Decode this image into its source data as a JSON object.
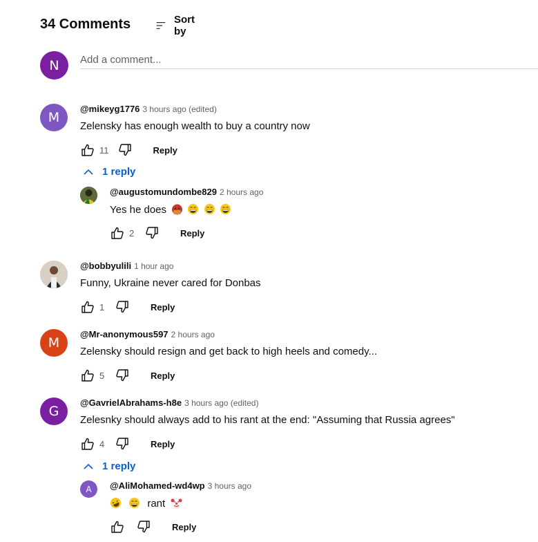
{
  "header": {
    "count_label": "34 Comments",
    "sort_label": "Sort by"
  },
  "add_comment": {
    "avatar_letter": "N",
    "avatar_color": "#7b1fa2",
    "placeholder": "Add a comment..."
  },
  "comments": [
    {
      "author": "@mikeyg1776",
      "time": "3 hours ago (edited)",
      "text": "Zelensky has enough wealth to buy a country now",
      "likes": "11",
      "reply_label": "Reply",
      "avatar_letter": "M",
      "avatar_color": "#7e57c2",
      "replies_toggle": "1 reply",
      "reply": {
        "author": "@augustomundombe829",
        "time": "2 hours ago",
        "text": "Yes he does",
        "emojis": [
          "angry-clenched-face-emoji",
          "grinning-sweat-emoji",
          "grinning-sweat-emoji",
          "grinning-sweat-emoji"
        ],
        "likes": "2",
        "reply_label": "Reply",
        "avatar": "photo"
      }
    },
    {
      "author": "@bobbyulili",
      "time": "1 hour ago",
      "text": "Funny, Ukraine never cared for Donbas",
      "likes": "1",
      "reply_label": "Reply",
      "avatar": "photo"
    },
    {
      "author": "@Mr-anonymous597",
      "time": "2 hours ago",
      "text": "Zelensky should resign and get back to high heels and comedy...",
      "likes": "5",
      "reply_label": "Reply",
      "avatar_letter": "M",
      "avatar_color": "#d84315"
    },
    {
      "author": "@GavrielAbrahams-h8e",
      "time": "3 hours ago (edited)",
      "text": "Zelesnky should always add to his rant at the end: \"Assuming that Russia agrees\"",
      "likes": "4",
      "reply_label": "Reply",
      "avatar_letter": "G",
      "avatar_color": "#7b1fa2",
      "replies_toggle": "1 reply",
      "reply": {
        "author": "@AliMohamed-wd4wp",
        "time": "3 hours ago",
        "text": "rant",
        "emojis_before": [
          "rolling-laughing-emoji",
          "grinning-sweat-emoji"
        ],
        "emojis_after": [
          "clown-face-emoji"
        ],
        "likes": "",
        "reply_label": "Reply",
        "avatar_letter": "A",
        "avatar_color": "#7e57c2"
      }
    }
  ],
  "icons": {
    "sort": "sort-lines-icon",
    "like": "thumbs-up-icon",
    "dislike": "thumbs-down-icon",
    "chevron": "chevron-up-icon"
  },
  "colors": {
    "link_blue": "#065fd4",
    "muted": "#606060",
    "text": "#0f0f0f"
  }
}
